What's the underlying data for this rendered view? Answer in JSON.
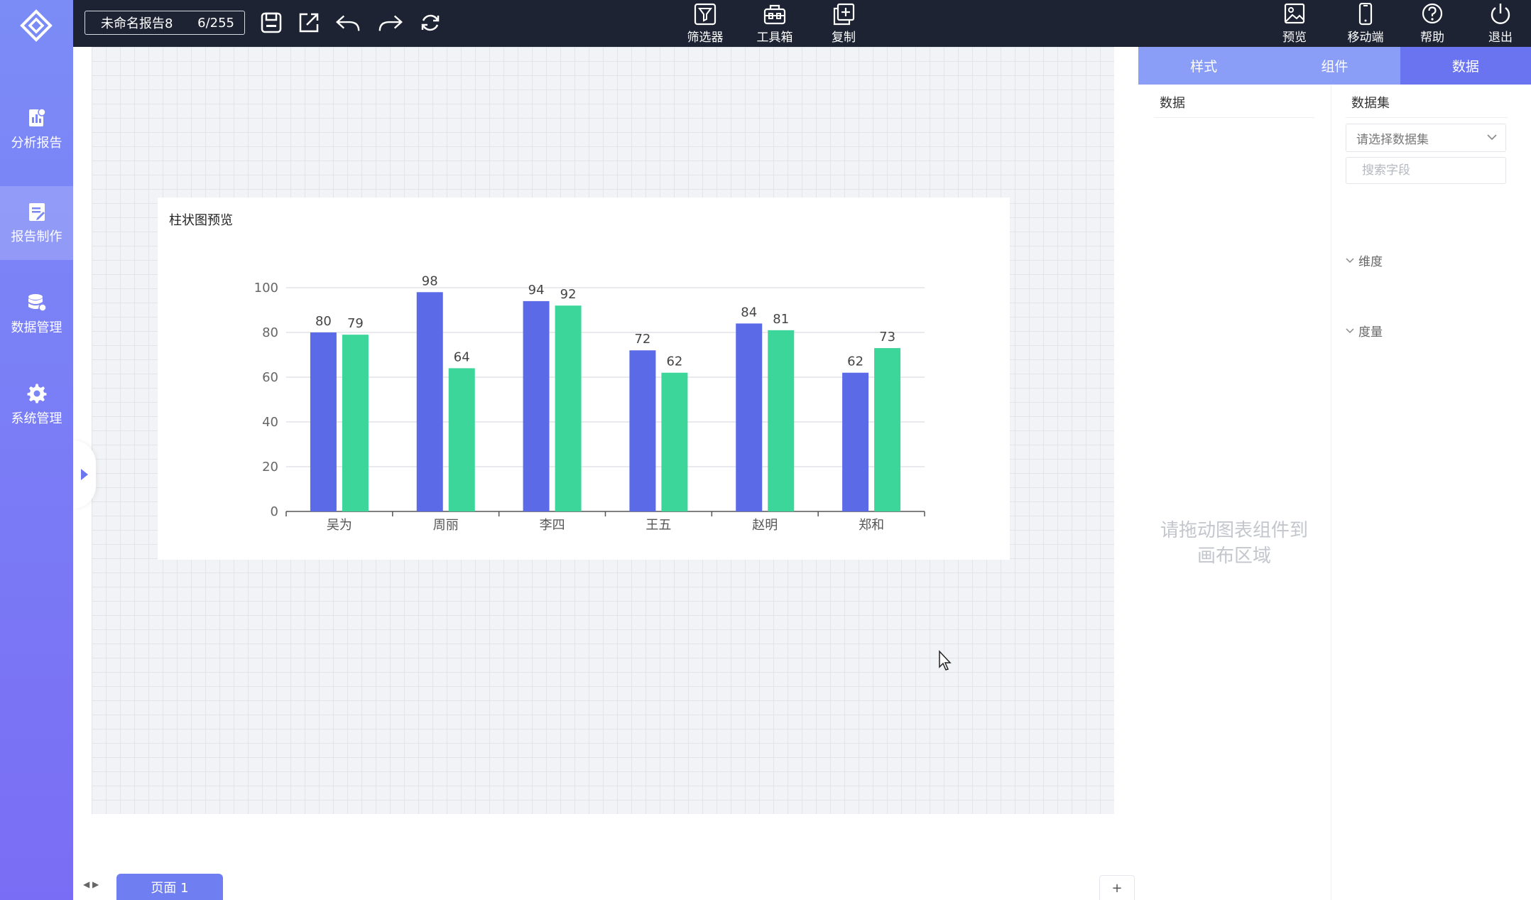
{
  "sidebar": {
    "logo": "diamond-logo",
    "items": [
      {
        "label": "分析报告",
        "icon": "report-analysis-icon"
      },
      {
        "label": "报告制作",
        "icon": "report-edit-icon",
        "active": true
      },
      {
        "label": "数据管理",
        "icon": "database-icon"
      },
      {
        "label": "系统管理",
        "icon": "gear-icon"
      }
    ]
  },
  "topbar": {
    "report_name": "未命名报告8",
    "char_count": "6/255",
    "tools": [
      {
        "label": "筛选器",
        "icon": "filter-icon"
      },
      {
        "label": "工具箱",
        "icon": "toolbox-icon"
      },
      {
        "label": "复制",
        "icon": "copy-icon"
      }
    ],
    "right_tools": [
      {
        "label": "预览",
        "icon": "preview-icon"
      },
      {
        "label": "移动端",
        "icon": "mobile-icon"
      },
      {
        "label": "帮助",
        "icon": "help-icon"
      },
      {
        "label": "退出",
        "icon": "power-icon"
      }
    ]
  },
  "chart_data": {
    "type": "bar",
    "title": "柱状图预览",
    "categories": [
      "吴为",
      "周丽",
      "李四",
      "王五",
      "赵明",
      "郑和"
    ],
    "series": [
      {
        "values": [
          80,
          98,
          94,
          72,
          84,
          62
        ],
        "color": "#5b6be8"
      },
      {
        "values": [
          79,
          64,
          92,
          62,
          81,
          73
        ],
        "color": "#3dd69a"
      }
    ],
    "ylim": [
      0,
      100
    ],
    "yticks": [
      0,
      20,
      40,
      60,
      80,
      100
    ],
    "grid": true,
    "data_labels": true
  },
  "right_panel": {
    "tabs": [
      {
        "label": "样式"
      },
      {
        "label": "组件"
      },
      {
        "label": "数据",
        "active": true
      }
    ],
    "data_header": "数据",
    "dataset_header": "数据集",
    "dataset_placeholder": "请选择数据集",
    "search_placeholder": "搜索字段",
    "dimension_label": "维度",
    "measure_label": "度量",
    "drop_hint": "请拖动图表组件到画布区域"
  },
  "bottom": {
    "page_tab": "页面 1",
    "add_label": "+"
  }
}
